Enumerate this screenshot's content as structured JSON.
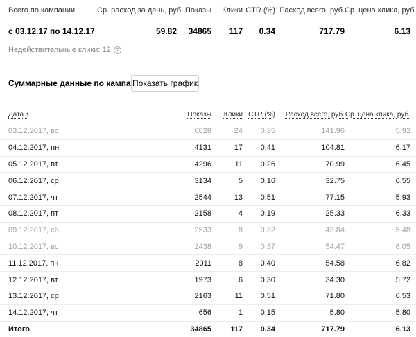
{
  "summary": {
    "headers": [
      "Всего по кампании",
      "Ср. расход за день, руб.",
      "Показы",
      "Клики",
      "CTR (%)",
      "Расход всего, руб.",
      "Ср. цена клика, руб."
    ],
    "values": [
      "с 03.12.17 по 14.12.17",
      "59.82",
      "34865",
      "117",
      "0.34",
      "717.79",
      "6.13"
    ]
  },
  "invalid_clicks": "Недействительные клики: 12",
  "section_title": "Суммарные данные по кампании",
  "show_chart_button": "Показать график",
  "table": {
    "headers": [
      "Дата ↑",
      "Показы",
      "Клики",
      "CTR (%)",
      "Расход всего, руб.",
      "Ср. цена клика, руб."
    ],
    "rows": [
      {
        "date": "03.12.2017, вс",
        "impressions": "6828",
        "clicks": "24",
        "ctr": "0.35",
        "cost": "141.96",
        "cpc": "5.92",
        "muted": true
      },
      {
        "date": "04.12.2017, пн",
        "impressions": "4131",
        "clicks": "17",
        "ctr": "0.41",
        "cost": "104.81",
        "cpc": "6.17",
        "muted": false
      },
      {
        "date": "05.12.2017, вт",
        "impressions": "4296",
        "clicks": "11",
        "ctr": "0.26",
        "cost": "70.99",
        "cpc": "6.45",
        "muted": false
      },
      {
        "date": "06.12.2017, ср",
        "impressions": "3134",
        "clicks": "5",
        "ctr": "0.16",
        "cost": "32.75",
        "cpc": "6.55",
        "muted": false
      },
      {
        "date": "07.12.2017, чт",
        "impressions": "2544",
        "clicks": "13",
        "ctr": "0.51",
        "cost": "77.15",
        "cpc": "5.93",
        "muted": false
      },
      {
        "date": "08.12.2017, пт",
        "impressions": "2158",
        "clicks": "4",
        "ctr": "0.19",
        "cost": "25.33",
        "cpc": "6.33",
        "muted": false
      },
      {
        "date": "09.12.2017, сб",
        "impressions": "2533",
        "clicks": "8",
        "ctr": "0.32",
        "cost": "43.84",
        "cpc": "5.48",
        "muted": true
      },
      {
        "date": "10.12.2017, вс",
        "impressions": "2438",
        "clicks": "9",
        "ctr": "0.37",
        "cost": "54.47",
        "cpc": "6.05",
        "muted": true
      },
      {
        "date": "11.12.2017, пн",
        "impressions": "2011",
        "clicks": "8",
        "ctr": "0.40",
        "cost": "54.58",
        "cpc": "6.82",
        "muted": false
      },
      {
        "date": "12.12.2017, вт",
        "impressions": "1973",
        "clicks": "6",
        "ctr": "0.30",
        "cost": "34.30",
        "cpc": "5.72",
        "muted": false
      },
      {
        "date": "13.12.2017, ср",
        "impressions": "2163",
        "clicks": "11",
        "ctr": "0.51",
        "cost": "71.80",
        "cpc": "6.53",
        "muted": false
      },
      {
        "date": "14.12.2017, чт",
        "impressions": "656",
        "clicks": "1",
        "ctr": "0.15",
        "cost": "5.80",
        "cpc": "5.80",
        "muted": false
      }
    ],
    "total": {
      "date": "Итого",
      "impressions": "34865",
      "clicks": "117",
      "ctr": "0.34",
      "cost": "717.79",
      "cpc": "6.13"
    }
  }
}
